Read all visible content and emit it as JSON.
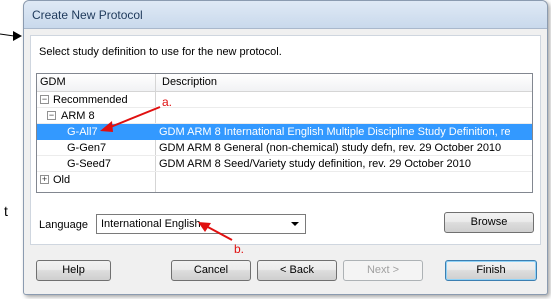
{
  "window": {
    "title": "Create New Protocol"
  },
  "prompt": "Select study definition to use for the new protocol.",
  "table": {
    "columns": [
      "GDM",
      "Description"
    ],
    "rows": [
      {
        "gdm": "Recommended",
        "desc": "",
        "expander": "−"
      },
      {
        "gdm": "ARM 8",
        "desc": "",
        "expander": "−"
      },
      {
        "gdm": "G-All7",
        "desc": "GDM ARM 8 International English Multiple Discipline Study Definition, re",
        "selected": true
      },
      {
        "gdm": "G-Gen7",
        "desc": "GDM ARM 8 General (non-chemical) study defn, rev. 29 October 2010"
      },
      {
        "gdm": "G-Seed7",
        "desc": "GDM ARM 8 Seed/Variety study definition, rev. 29 October 2010"
      },
      {
        "gdm": "Old",
        "desc": "",
        "expander": "+"
      }
    ]
  },
  "language": {
    "label": "Language",
    "value": "International English"
  },
  "buttons": {
    "browse": "Browse",
    "help": "Help",
    "cancel": "Cancel",
    "back": "< Back",
    "next": "Next >",
    "finish": "Finish"
  },
  "annotations": {
    "a": "a.",
    "b": "b."
  },
  "outside": {
    "t": "t"
  },
  "colors": {
    "selection": "#3399ff",
    "annotation": "#e01010"
  }
}
